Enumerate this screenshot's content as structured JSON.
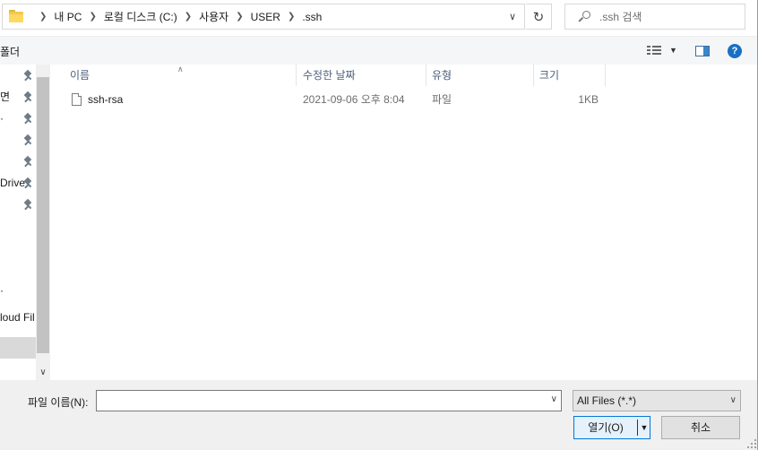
{
  "address": {
    "breadcrumbs": [
      "내 PC",
      "로컬 디스크 (C:)",
      "사용자",
      "USER",
      ".ssh"
    ]
  },
  "search": {
    "placeholder": ".ssh 검색"
  },
  "toolbar": {
    "new_folder_label": "폴더"
  },
  "nav_pane": {
    "items": [
      {
        "label": "",
        "pinned": true
      },
      {
        "label": "면",
        "pinned": true
      },
      {
        "label": "·",
        "pinned": true
      },
      {
        "label": "",
        "pinned": true
      },
      {
        "label": "",
        "pinned": true
      },
      {
        "label": "Drive",
        "pinned": true
      },
      {
        "label": "",
        "pinned": true
      },
      {
        "label": "·",
        "pinned": false
      },
      {
        "label": "loud Fil",
        "pinned": false
      }
    ]
  },
  "file_list": {
    "columns": [
      "이름",
      "수정한 날짜",
      "유형",
      "크기"
    ],
    "rows": [
      {
        "name": "ssh-rsa",
        "modified": "2021-09-06 오후 8:04",
        "type": "파일",
        "size": "1KB"
      }
    ]
  },
  "bottom": {
    "filename_label": "파일 이름(N):",
    "filename_value": "",
    "file_type": "All Files (*.*)",
    "open_label": "열기(O)",
    "cancel_label": "취소"
  },
  "icons": {
    "folder": "folder-icon",
    "refresh": "refresh-icon",
    "search": "search-icon",
    "help": "help-icon",
    "pin": "pin-icon",
    "file": "file-icon"
  },
  "colors": {
    "accent": "#0078d7",
    "help": "#1a6fc4",
    "header_text": "#4c607a"
  }
}
